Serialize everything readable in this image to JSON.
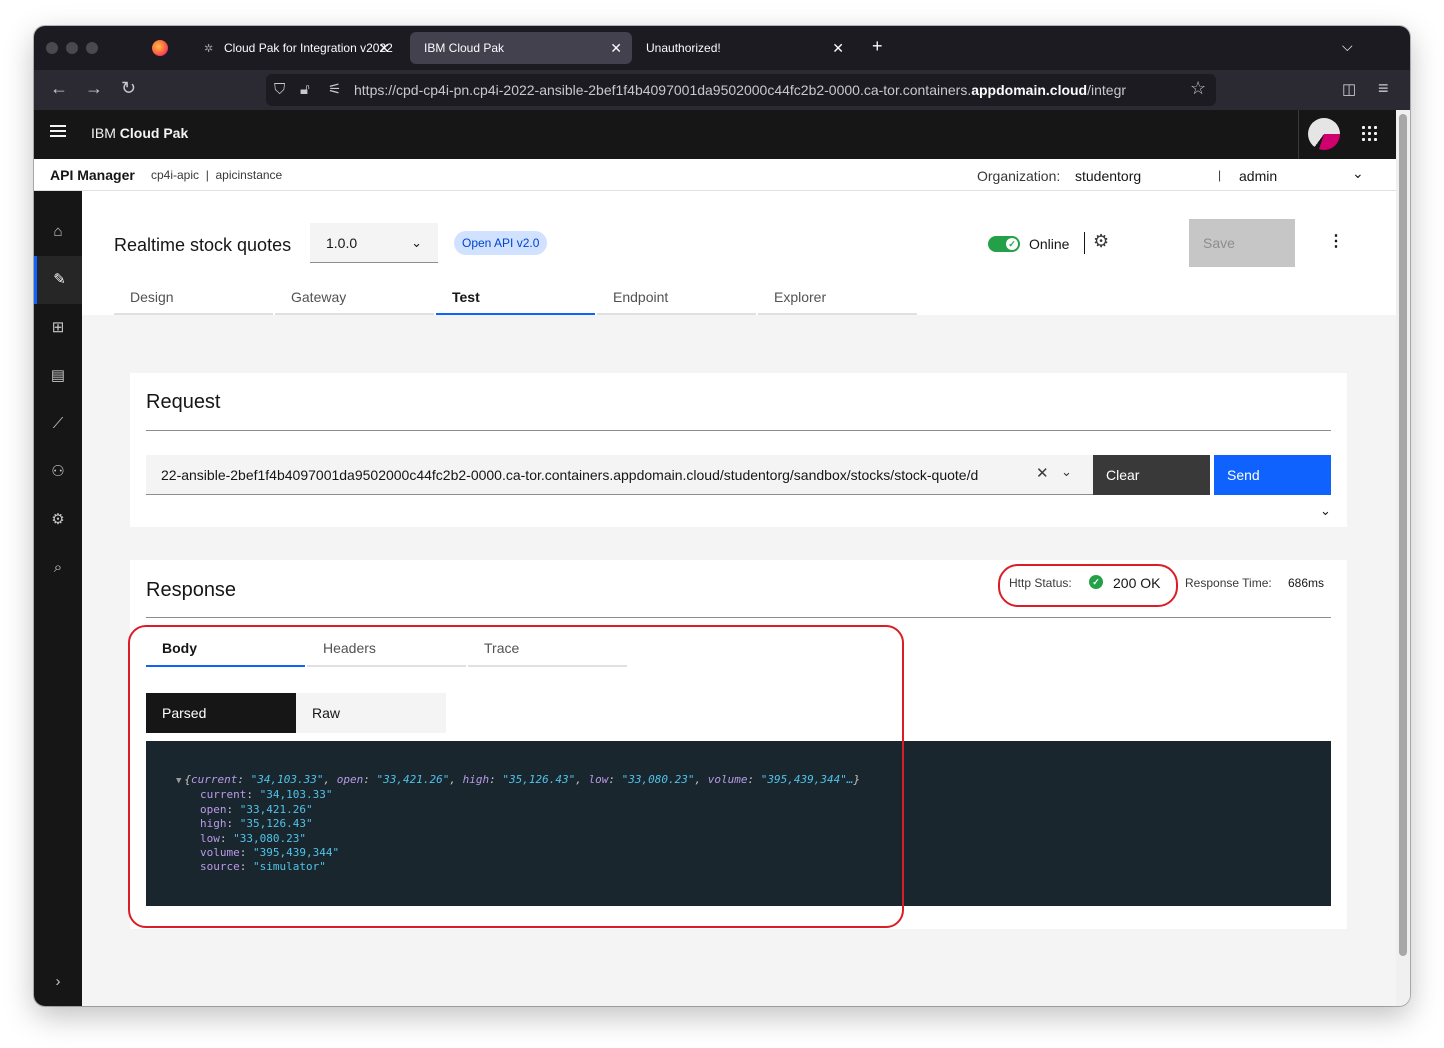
{
  "browser": {
    "tabs": [
      {
        "label": "Cloud Pak for Integration v2022"
      },
      {
        "label": "IBM Cloud Pak"
      },
      {
        "label": "Unauthorized!"
      }
    ],
    "url_prefix": "https://cpd-cp4i-pn.cp4i-2022-ansible-2bef1f4b4097001da9502000c44fc2b2-0000.ca-tor.containers.",
    "url_domain": "appdomain.cloud",
    "url_suffix": "/integr"
  },
  "header": {
    "brand_prefix": "IBM",
    "brand_name": "Cloud Pak"
  },
  "subheader": {
    "title": "API Manager",
    "crumb1": "cp4i-apic",
    "crumb_sep": "|",
    "crumb2": "apicinstance",
    "org_label": "Organization:",
    "org_value": "studentorg",
    "sep": "|",
    "user": "admin"
  },
  "sidenav": {
    "items": [
      "home-icon",
      "edit-icon",
      "apps-icon",
      "catalog-icon",
      "analytics-icon",
      "members-icon",
      "settings-icon",
      "search-icon",
      "expand-icon"
    ]
  },
  "api": {
    "name": "Realtime stock quotes",
    "version": "1.0.0",
    "spec_tag": "Open API v2.0",
    "status": "Online",
    "save_label": "Save"
  },
  "tabs": [
    {
      "label": "Design"
    },
    {
      "label": "Gateway"
    },
    {
      "label": "Test"
    },
    {
      "label": "Endpoint"
    },
    {
      "label": "Explorer"
    }
  ],
  "request": {
    "title": "Request",
    "url_value": "22-ansible-2bef1f4b4097001da9502000c44fc2b2-0000.ca-tor.containers.appdomain.cloud/studentorg/sandbox/stocks/stock-quote/d",
    "clear_label": "Clear",
    "send_label": "Send"
  },
  "response": {
    "title": "Response",
    "http_status_label": "Http Status:",
    "http_status_value": "200 OK",
    "response_time_label": "Response Time:",
    "response_time_value": "686ms",
    "tabs": [
      {
        "label": "Body"
      },
      {
        "label": "Headers"
      },
      {
        "label": "Trace"
      }
    ],
    "view_modes": [
      {
        "label": "Parsed"
      },
      {
        "label": "Raw"
      }
    ],
    "body": {
      "summary": {
        "current": "\"34,103.33\"",
        "open": "\"33,421.26\"",
        "high": "\"35,126.43\"",
        "low": "\"33,080.23\"",
        "volume": "\"395,439,344\"…"
      },
      "fields": [
        {
          "key": "current",
          "value": "\"34,103.33\""
        },
        {
          "key": "open",
          "value": "\"33,421.26\""
        },
        {
          "key": "high",
          "value": "\"35,126.43\""
        },
        {
          "key": "low",
          "value": "\"33,080.23\""
        },
        {
          "key": "volume",
          "value": "\"395,439,344\""
        },
        {
          "key": "source",
          "value": "\"simulator\""
        }
      ]
    }
  },
  "colors": {
    "accent": "#0f62fe",
    "success": "#24a148",
    "highlight": "#da1e28",
    "code_bg": "#1a262e"
  }
}
